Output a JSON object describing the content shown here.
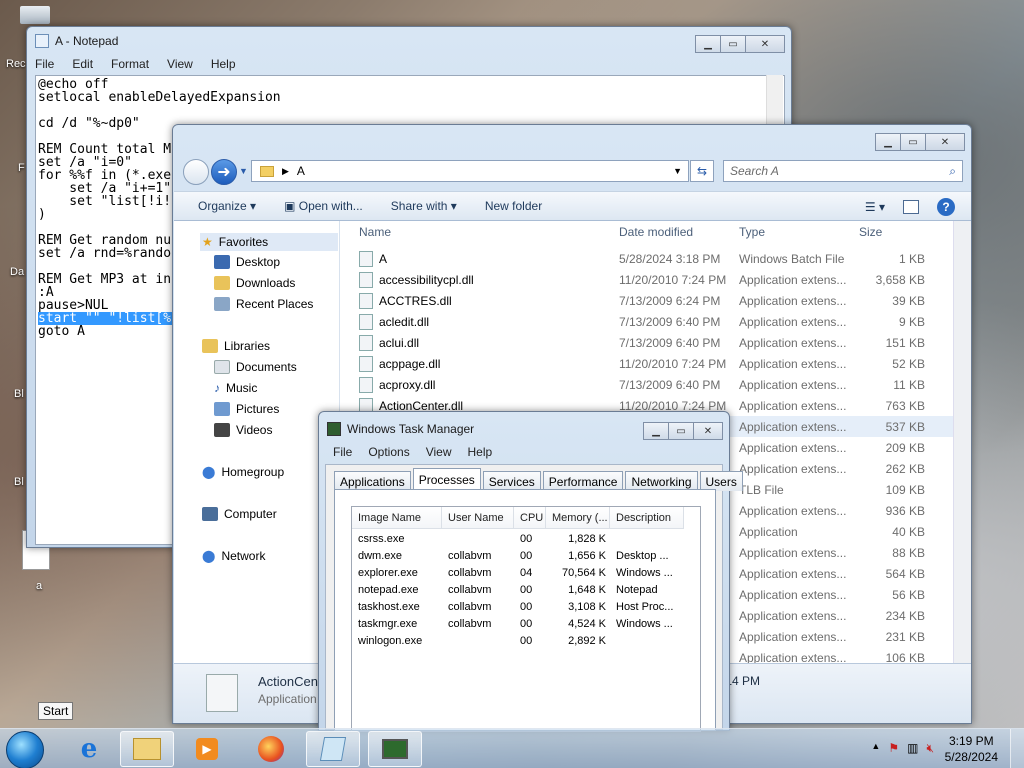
{
  "desktop": {
    "icons": [
      {
        "label": "Rec",
        "glyph": "recycle-bin-icon"
      },
      {
        "label": "F"
      },
      {
        "label": "Da"
      },
      {
        "label": "Bl"
      },
      {
        "label": "Bl"
      },
      {
        "label": "a"
      }
    ],
    "start_tooltip": "Start"
  },
  "notepad": {
    "title": "A - Notepad",
    "menu": [
      "File",
      "Edit",
      "Format",
      "View",
      "Help"
    ],
    "lines": [
      "@echo off",
      "setlocal enableDelayedExpansion",
      "",
      "cd /d \"%~dp0\"",
      "",
      "REM Count total M",
      "set /a \"i=0\"",
      "for %%f in (*.exe",
      "    set /a \"i+=1\"",
      "    set \"list[!i!",
      ")",
      "",
      "REM Get random nu",
      "set /a rnd=%rando",
      "",
      "REM Get MP3 at in",
      ":A",
      "pause>NUL",
      "start \"\" \"!list[%",
      "goto A"
    ],
    "selected_line_index": 18
  },
  "explorer": {
    "address": "A",
    "search_placeholder": "Search A",
    "toolbar": {
      "organize": "Organize",
      "open_with": "Open with...",
      "share_with": "Share with",
      "new_folder": "New folder"
    },
    "nav": {
      "favorites": "Favorites",
      "desktop": "Desktop",
      "downloads": "Downloads",
      "recent_places": "Recent Places",
      "libraries": "Libraries",
      "documents": "Documents",
      "music": "Music",
      "pictures": "Pictures",
      "videos": "Videos",
      "homegroup": "Homegroup",
      "computer": "Computer",
      "network": "Network"
    },
    "columns": {
      "name": "Name",
      "date": "Date modified",
      "type": "Type",
      "size": "Size"
    },
    "files": [
      {
        "name": "A",
        "date": "5/28/2024 3:18 PM",
        "type": "Windows Batch File",
        "size": "1 KB"
      },
      {
        "name": "accessibilitycpl.dll",
        "date": "11/20/2010 7:24 PM",
        "type": "Application extens...",
        "size": "3,658 KB"
      },
      {
        "name": "ACCTRES.dll",
        "date": "7/13/2009 6:24 PM",
        "type": "Application extens...",
        "size": "39 KB"
      },
      {
        "name": "acledit.dll",
        "date": "7/13/2009 6:40 PM",
        "type": "Application extens...",
        "size": "9 KB"
      },
      {
        "name": "aclui.dll",
        "date": "7/13/2009 6:40 PM",
        "type": "Application extens...",
        "size": "151 KB"
      },
      {
        "name": "acppage.dll",
        "date": "11/20/2010 7:24 PM",
        "type": "Application extens...",
        "size": "52 KB"
      },
      {
        "name": "acproxy.dll",
        "date": "7/13/2009 6:40 PM",
        "type": "Application extens...",
        "size": "11 KB"
      },
      {
        "name": "ActionCenter.dll",
        "date": "11/20/2010 7:24 PM",
        "type": "Application extens...",
        "size": "763 KB"
      },
      {
        "name": "",
        "date": "",
        "type": "Application extens...",
        "size": "537 KB"
      },
      {
        "name": "",
        "date": "",
        "type": "Application extens...",
        "size": "209 KB"
      },
      {
        "name": "",
        "date": "",
        "type": "Application extens...",
        "size": "262 KB"
      },
      {
        "name": "",
        "date": "",
        "type": "TLB File",
        "size": "109 KB"
      },
      {
        "name": "",
        "date": "",
        "type": "Application extens...",
        "size": "936 KB"
      },
      {
        "name": "",
        "date": "",
        "type": "Application",
        "size": "40 KB"
      },
      {
        "name": "",
        "date": "",
        "type": "Application extens...",
        "size": "88 KB"
      },
      {
        "name": "",
        "date": "",
        "type": "Application extens...",
        "size": "564 KB"
      },
      {
        "name": "",
        "date": "",
        "type": "Application extens...",
        "size": "56 KB"
      },
      {
        "name": "",
        "date": "",
        "type": "Application extens...",
        "size": "234 KB"
      },
      {
        "name": "",
        "date": "",
        "type": "Application extens...",
        "size": "231 KB"
      },
      {
        "name": "",
        "date": "",
        "type": "Application extens...",
        "size": "106 KB"
      }
    ],
    "details_pane": {
      "name": "ActionCent",
      "type": "Application",
      "date_fragment": ":14 PM"
    }
  },
  "taskmgr": {
    "title": "Windows Task Manager",
    "menu": [
      "File",
      "Options",
      "View",
      "Help"
    ],
    "tabs": [
      "Applications",
      "Processes",
      "Services",
      "Performance",
      "Networking",
      "Users"
    ],
    "active_tab": "Processes",
    "columns": {
      "image": "Image Name",
      "user": "User Name",
      "cpu": "CPU",
      "memory": "Memory (...",
      "desc": "Description"
    },
    "processes": [
      {
        "image": "csrss.exe",
        "user": "",
        "cpu": "00",
        "memory": "1,828 K",
        "desc": ""
      },
      {
        "image": "dwm.exe",
        "user": "collabvm",
        "cpu": "00",
        "memory": "1,656 K",
        "desc": "Desktop ..."
      },
      {
        "image": "explorer.exe",
        "user": "collabvm",
        "cpu": "04",
        "memory": "70,564 K",
        "desc": "Windows ..."
      },
      {
        "image": "notepad.exe",
        "user": "collabvm",
        "cpu": "00",
        "memory": "1,648 K",
        "desc": "Notepad"
      },
      {
        "image": "taskhost.exe",
        "user": "collabvm",
        "cpu": "00",
        "memory": "3,108 K",
        "desc": "Host Proc..."
      },
      {
        "image": "taskmgr.exe",
        "user": "collabvm",
        "cpu": "00",
        "memory": "4,524 K",
        "desc": "Windows ..."
      },
      {
        "image": "winlogon.exe",
        "user": "",
        "cpu": "00",
        "memory": "2,892 K",
        "desc": ""
      }
    ]
  },
  "taskbar": {
    "time": "3:19 PM",
    "date": "5/28/2024",
    "tray_arrow": "▲"
  }
}
